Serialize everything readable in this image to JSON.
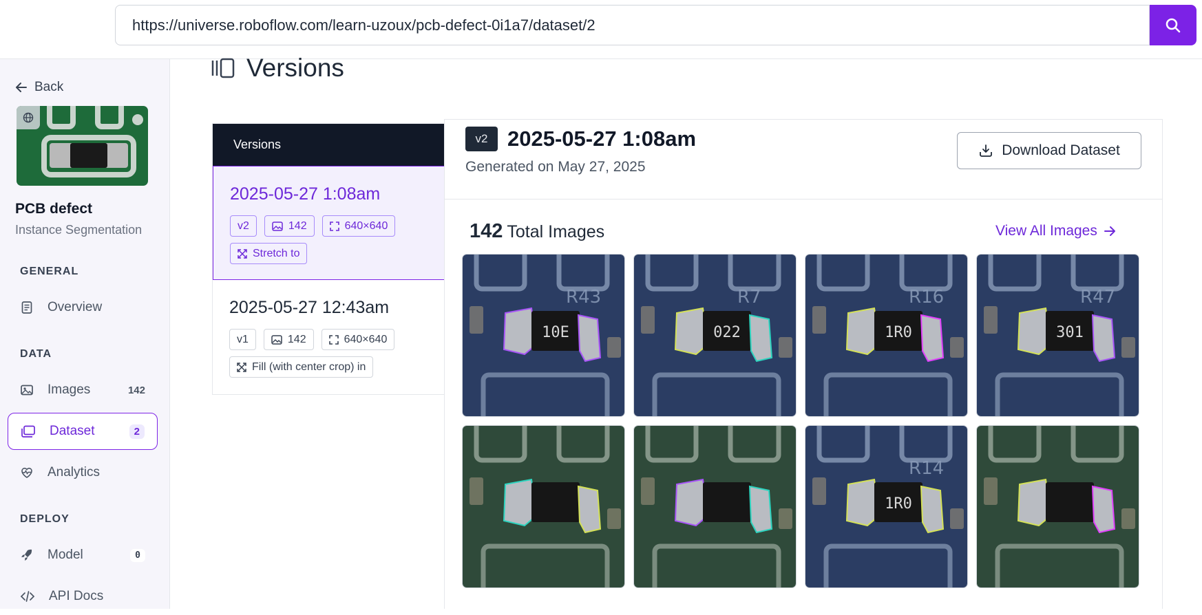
{
  "browser": {
    "url": "https://universe.roboflow.com/learn-uzoux/pcb-defect-0i1a7/dataset/2"
  },
  "sidebar": {
    "back_label": "Back",
    "project_name": "PCB defect",
    "project_type": "Instance Segmentation",
    "sections": {
      "general": "GENERAL",
      "data": "DATA",
      "deploy": "DEPLOY"
    },
    "items": {
      "overview": {
        "label": "Overview"
      },
      "images": {
        "label": "Images",
        "count": "142"
      },
      "dataset": {
        "label": "Dataset",
        "count": "2"
      },
      "analytics": {
        "label": "Analytics"
      },
      "model": {
        "label": "Model",
        "count": "0"
      },
      "api_docs": {
        "label": "API Docs"
      }
    }
  },
  "main": {
    "title": "Versions",
    "versions_header": "Versions",
    "versions": [
      {
        "date": "2025-05-27 1:08am",
        "version": "v2",
        "images": "142",
        "size": "640×640",
        "resize": "Stretch to",
        "active": true
      },
      {
        "date": "2025-05-27 12:43am",
        "version": "v1",
        "images": "142",
        "size": "640×640",
        "resize": "Fill (with center crop) in",
        "active": false
      }
    ],
    "detail": {
      "badge": "v2",
      "title": "2025-05-27 1:08am",
      "generated": "Generated on May 27, 2025",
      "download_label": "Download Dataset",
      "total_count": "142",
      "total_label": "Total Images",
      "view_all_label": "View All Images"
    },
    "images": [
      {
        "board": "blue",
        "text": "R43",
        "marking": "10E"
      },
      {
        "board": "blue",
        "text": "R7",
        "marking": "022"
      },
      {
        "board": "blue",
        "text": "R16",
        "marking": "1R0"
      },
      {
        "board": "blue",
        "text": "R47",
        "marking": "301"
      },
      {
        "board": "green",
        "text": "",
        "marking": ""
      },
      {
        "board": "green",
        "text": "",
        "marking": ""
      },
      {
        "board": "blue",
        "text": "R14",
        "marking": "1R0"
      },
      {
        "board": "green",
        "text": "",
        "marking": ""
      }
    ]
  },
  "colors": {
    "accent": "#7c22e6",
    "dark": "#111827"
  }
}
